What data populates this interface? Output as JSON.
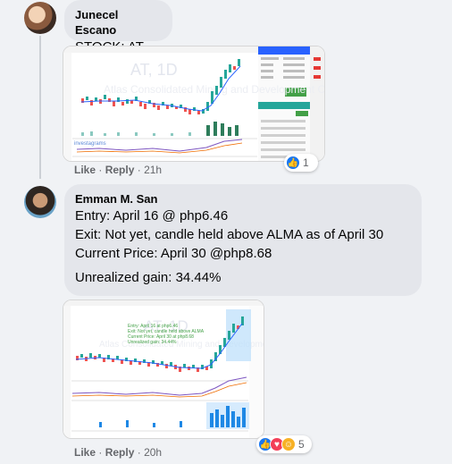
{
  "comments": [
    {
      "author": "Junecel Escano",
      "lines": [
        "STOCK: AT"
      ],
      "actions": {
        "like": "Like",
        "reply": "Reply",
        "time": "21h"
      },
      "reaction_count": "1",
      "attachment": {
        "title": "AT, 1D",
        "company": "Atlas Consolidated Mining and Development Cor"
      }
    },
    {
      "author": "Emman M. San",
      "lines": [
        "Entry: April 16 @ php6.46",
        "Exit: Not yet, candle held above ALMA as of April 30",
        "Current Price: April 30 @php8.68",
        "Unrealized gain: 34.44%"
      ],
      "actions": {
        "like": "Like",
        "reply": "Reply",
        "time": "20h"
      },
      "reaction_count": "5",
      "attachment": {
        "title": "AT, 1D",
        "company": "Atlas Consolidated Mining and Development Cor"
      }
    }
  ],
  "colors": {
    "bubble": "#e4e6eb",
    "like": "#1877f2",
    "up": "#26a69a",
    "down": "#ef5350"
  }
}
